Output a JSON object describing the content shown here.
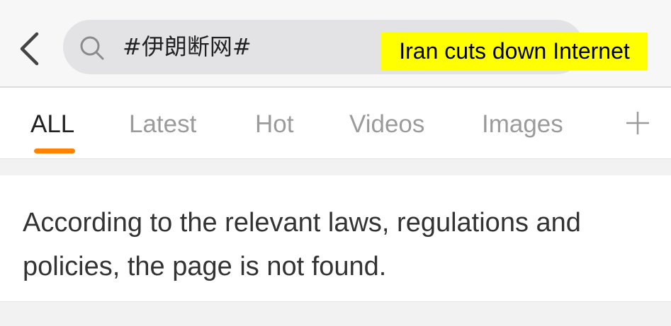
{
  "header": {
    "back_icon": "chevron-left-icon",
    "search_icon": "search-icon",
    "search_query": "#伊朗断网#",
    "annotation": "Iran cuts down Internet"
  },
  "tabs": [
    {
      "label": "ALL",
      "active": true
    },
    {
      "label": "Latest",
      "active": false
    },
    {
      "label": "Hot",
      "active": false
    },
    {
      "label": "Videos",
      "active": false
    },
    {
      "label": "Images",
      "active": false
    }
  ],
  "add_tab_icon": "plus-icon",
  "message": "According to the relevant laws, regulations and policies, the page is not found.",
  "colors": {
    "accent": "#ff8200",
    "annotation_bg": "#ffff00",
    "inactive_tab": "#9b9b9b"
  }
}
